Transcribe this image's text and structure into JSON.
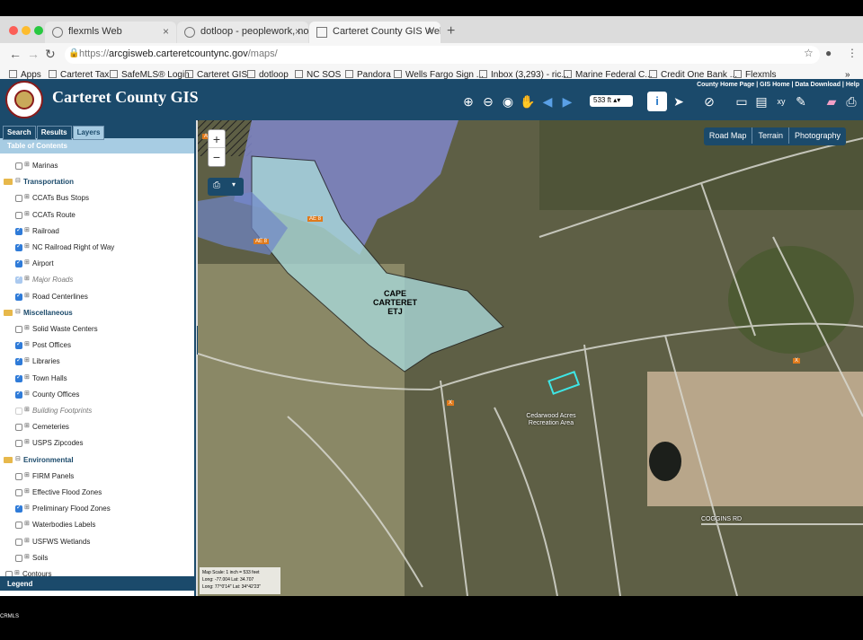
{
  "browser": {
    "tabs": [
      {
        "title": "flexmls Web",
        "active": false
      },
      {
        "title": "dotloop - peoplework, not pap",
        "active": false
      },
      {
        "title": "Carteret County GIS Website",
        "active": true
      }
    ],
    "url_prefix": "https://",
    "url_host": "arcgisweb.carteretcountync.gov",
    "url_path": "/maps/",
    "bookmarks": [
      "Apps",
      "Carteret Tax",
      "SafeMLS® Login",
      "Carteret GIS",
      "dotloop",
      "NC SOS",
      "Pandora",
      "Wells Fargo Sign ...",
      "Inbox (3,293) - ric...",
      "Marine Federal C...",
      "Credit One Bank ...",
      "Flexmls"
    ]
  },
  "app": {
    "title": "Carteret County GIS",
    "top_links": "County Home Page | GIS Home | Data Download | Help",
    "scale_select": "533 ft",
    "sidebar_tabs": [
      "Search",
      "Results",
      "Layers"
    ],
    "toc_title": "Table of Contents",
    "legend_label": "Legend"
  },
  "layers": [
    {
      "label": "Marinas",
      "type": "item",
      "checked": false
    },
    {
      "label": "Transportation",
      "type": "folder"
    },
    {
      "label": "CCATs Bus Stops",
      "type": "item",
      "checked": false
    },
    {
      "label": "CCATs Route",
      "type": "item",
      "checked": false
    },
    {
      "label": "Railroad",
      "type": "item",
      "checked": true
    },
    {
      "label": "NC Railroad Right of Way",
      "type": "item",
      "checked": true
    },
    {
      "label": "Airport",
      "type": "item",
      "checked": true
    },
    {
      "label": "Major Roads",
      "type": "item",
      "checked": true,
      "dim": true
    },
    {
      "label": "Road Centerlines",
      "type": "item",
      "checked": true
    },
    {
      "label": "Miscellaneous",
      "type": "folder"
    },
    {
      "label": "Solid Waste Centers",
      "type": "item",
      "checked": false
    },
    {
      "label": "Post Offices",
      "type": "item",
      "checked": true
    },
    {
      "label": "Libraries",
      "type": "item",
      "checked": true
    },
    {
      "label": "Town Halls",
      "type": "item",
      "checked": true
    },
    {
      "label": "County Offices",
      "type": "item",
      "checked": true
    },
    {
      "label": "Building Footprints",
      "type": "item",
      "checked": false,
      "dim": true
    },
    {
      "label": "Cemeteries",
      "type": "item",
      "checked": false
    },
    {
      "label": "USPS Zipcodes",
      "type": "item",
      "checked": false
    },
    {
      "label": "Environmental",
      "type": "folder"
    },
    {
      "label": "FIRM Panels",
      "type": "item",
      "checked": false
    },
    {
      "label": "Effective Flood Zones",
      "type": "item",
      "checked": false
    },
    {
      "label": "Preliminary Flood Zones",
      "type": "item",
      "checked": true
    },
    {
      "label": "Waterbodies Labels",
      "type": "item",
      "checked": false
    },
    {
      "label": "USFWS Wetlands",
      "type": "item",
      "checked": false
    },
    {
      "label": "Soils",
      "type": "item",
      "checked": false
    },
    {
      "label": "Contours",
      "type": "root-item",
      "checked": false
    }
  ],
  "map": {
    "basemaps": [
      "Road Map",
      "Terrain",
      "Photography"
    ],
    "etj_label": [
      "CAPE",
      "CARTERET",
      "ETJ"
    ],
    "place_labels": [
      "Cedarwood Acres Recreation Area",
      "COGGINS RD"
    ],
    "scale_info": [
      "Map Scale: 1 inch = 533 feet",
      "Long: -77.004 Lat: 34.707",
      "Long: 77°0'14\" Lat: 34°42'23\""
    ]
  },
  "footer_text": "CRMLS"
}
